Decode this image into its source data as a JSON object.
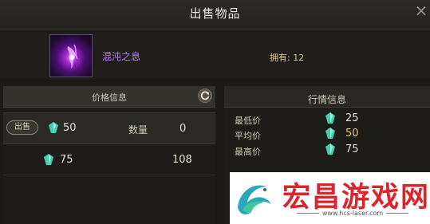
{
  "window": {
    "title": "出售物品"
  },
  "item": {
    "name": "混沌之息",
    "owned": "拥有: 12"
  },
  "price_panel": {
    "header": "价格信息",
    "sell_label": "出售",
    "selected_row": {
      "price": "50",
      "qty_label": "数量",
      "qty": "0"
    },
    "other_row": {
      "price": "75",
      "qty": "108"
    }
  },
  "market_panel": {
    "header": "行情信息",
    "stats": [
      {
        "label": "最低价",
        "value": "25"
      },
      {
        "label": "平均价",
        "value": "50"
      },
      {
        "label": "最高价",
        "value": "75"
      }
    ]
  },
  "watermark": {
    "brand": "宏昌游戏网",
    "url": "www.hcs-laser.com"
  },
  "colors": {
    "item_name": "#b57cf0",
    "owned": "#e0c887",
    "average": "#f0c04a",
    "gem": "#3fd1b0"
  }
}
